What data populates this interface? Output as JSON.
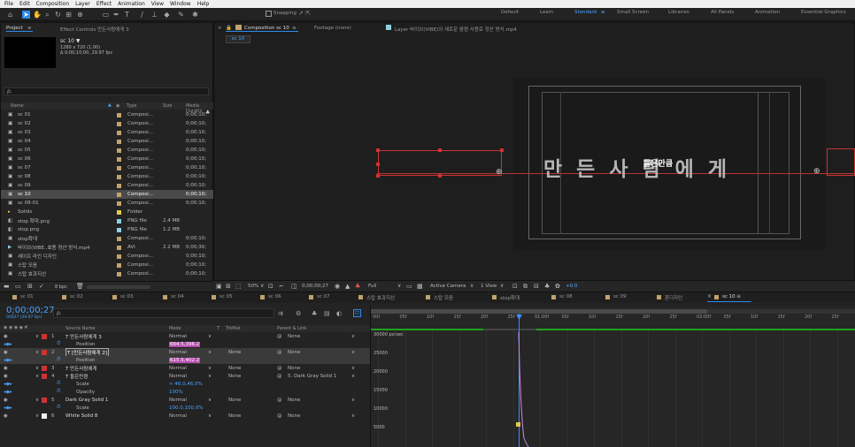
{
  "menu": [
    "File",
    "Edit",
    "Composition",
    "Layer",
    "Effect",
    "Animation",
    "View",
    "Window",
    "Help"
  ],
  "toolbar": {
    "snapping_label": "Snapping",
    "workspaces": [
      "Default",
      "Learn",
      "Standard",
      "Small Screen",
      "Libraries",
      "All Panels",
      "Animation",
      "Essential Graphics"
    ],
    "active_workspace": "Standard"
  },
  "project": {
    "tab_label": "Project",
    "effect_controls_label": "Effect Controls 만든사람에게 3",
    "selected_name": "sc 10 ▼",
    "selected_info1": "1280 x 720 (1.00)",
    "selected_info2": "Δ 0;00;10;00, 29.97 fps",
    "search_placeholder": "ρ.",
    "columns": [
      "Name",
      "Type",
      "Size",
      "Media Duratio"
    ],
    "items": [
      {
        "name": "sc 01",
        "type": "Composi...",
        "size": "",
        "duration": "0;00;10;"
      },
      {
        "name": "sc 02",
        "type": "Composi...",
        "size": "",
        "duration": "0;00;10;"
      },
      {
        "name": "sc 03",
        "type": "Composi...",
        "size": "",
        "duration": "0;00;10;"
      },
      {
        "name": "sc 04",
        "type": "Composi...",
        "size": "",
        "duration": "0;00;10;"
      },
      {
        "name": "sc 05",
        "type": "Composi...",
        "size": "",
        "duration": "0;00;10;"
      },
      {
        "name": "sc 06",
        "type": "Composi...",
        "size": "",
        "duration": "0;00;10;"
      },
      {
        "name": "sc 07",
        "type": "Composi...",
        "size": "",
        "duration": "0;00;10;"
      },
      {
        "name": "sc 08",
        "type": "Composi...",
        "size": "",
        "duration": "0;00;10;"
      },
      {
        "name": "sc 09",
        "type": "Composi...",
        "size": "",
        "duration": "0;00;10;"
      },
      {
        "name": "sc 10",
        "type": "Composi...",
        "size": "",
        "duration": "0;00;10;"
      },
      {
        "name": "sc 08-01",
        "type": "Composi...",
        "size": "",
        "duration": "0;00;10;"
      },
      {
        "name": "Solids",
        "type": "Folder",
        "size": "",
        "duration": ""
      },
      {
        "name": "stop 확대.png",
        "type": "PNG file",
        "size": "2.4 MB",
        "duration": ""
      },
      {
        "name": "stop.png",
        "type": "PNG file",
        "size": "1.2 MB",
        "duration": ""
      },
      {
        "name": "stop확대",
        "type": "Composi...",
        "size": "",
        "duration": "0;00;10;"
      },
      {
        "name": "바이브(VIBE..효용 정산 방식.mp4",
        "type": "AVI",
        "size": "2.2 MB",
        "duration": "0;00;30;"
      },
      {
        "name": "셰이프 라인 디자인",
        "type": "Composi...",
        "size": "",
        "duration": "0;00;10;"
      },
      {
        "name": "스탑 모음",
        "type": "Composi...",
        "size": "",
        "duration": "0;00;10;"
      },
      {
        "name": "스탑 효과지선",
        "type": "Composi...",
        "size": "",
        "duration": "0;00;10;"
      }
    ],
    "footer_bpc": "8 bpc"
  },
  "viewer": {
    "comp_tab": "Composition sc 10",
    "footage_tab": "Footage (none)",
    "layer_tab": "Layer 바이브(VIBE)의 새로운 음원 사용료 정산 방식.mp4",
    "breadcrumb": "sc 10",
    "main_text": "만 든 사 람 에 게",
    "overlay_text": "들은만큼",
    "zoom": "50%",
    "timecode": "0;00;00;27",
    "resolution": "Full",
    "camera": "Active Camera",
    "views": "1 View",
    "exposure": "+0.0"
  },
  "timeline": {
    "tabs": [
      "sc 01",
      "sc 02",
      "sc 03",
      "sc 04",
      "sc 05",
      "sc 06",
      "sc 07",
      "스탑 효과지선",
      "스탑 모음",
      "stop확대",
      "sc 08",
      "sc 09",
      "흔디자인",
      "sc 10"
    ],
    "active_tab": "sc 10",
    "timecode": "0;00;00;27",
    "timecode_sub": "00027 (29.97 fps)",
    "columns": {
      "source": "Source Name",
      "mode": "Mode",
      "t": "T",
      "trkmat": "TrkMat",
      "parent": "Parent & Link"
    },
    "layers": [
      {
        "kind": "layer",
        "num": "1",
        "name": "T 만든사람에게 3",
        "mode": "Normal",
        "trkmat": "",
        "parent": "None"
      },
      {
        "kind": "prop",
        "name": "Position",
        "value": "664.5,396.2"
      },
      {
        "kind": "layer",
        "num": "2",
        "name": "T [만든사람에게 2]",
        "mode": "Normal",
        "trkmat": "None",
        "parent": "None"
      },
      {
        "kind": "prop",
        "name": "Position",
        "value": "615.5,402.2"
      },
      {
        "kind": "layer",
        "num": "3",
        "name": "T 만든사람에게",
        "mode": "Normal",
        "trkmat": "None",
        "parent": "None"
      },
      {
        "kind": "layer",
        "num": "4",
        "name": "T 들은만큼",
        "mode": "Normal",
        "trkmat": "None",
        "parent": "5. Dark Gray Solid 1"
      },
      {
        "kind": "prop",
        "name": "Scale",
        "value": "∞ 46.0,46.0%"
      },
      {
        "kind": "prop",
        "name": "Opacity",
        "value": "100%"
      },
      {
        "kind": "layer",
        "num": "5",
        "name": "Dark Gray Solid 1",
        "mode": "Normal",
        "trkmat": "None",
        "parent": "None"
      },
      {
        "kind": "prop",
        "name": "Scale",
        "value": "100.0,100.0%"
      },
      {
        "kind": "layer",
        "num": "6",
        "name": "White Solid 8",
        "mode": "Normal",
        "trkmat": "None",
        "parent": "None"
      }
    ],
    "ruler": [
      "00f",
      "05f",
      "10f",
      "15f",
      "20f",
      "25f",
      "01:00f",
      "05f",
      "10f",
      "15f",
      "20f",
      "25f",
      "02:00f",
      "05f",
      "10f",
      "15f",
      "20f",
      "25f"
    ],
    "graph_labels": [
      "30000 px/sec",
      "25000",
      "20000",
      "15000",
      "10000",
      "5000"
    ]
  },
  "colors": {
    "accent_blue": "#2d8ceb",
    "layer_red": "#c33333",
    "label_tan": "#c2a36b",
    "label_yellow": "#e6c84a",
    "playhead": "#3c8cff",
    "graph_line": "#c58ce6",
    "worarea": "#1fa31f"
  }
}
